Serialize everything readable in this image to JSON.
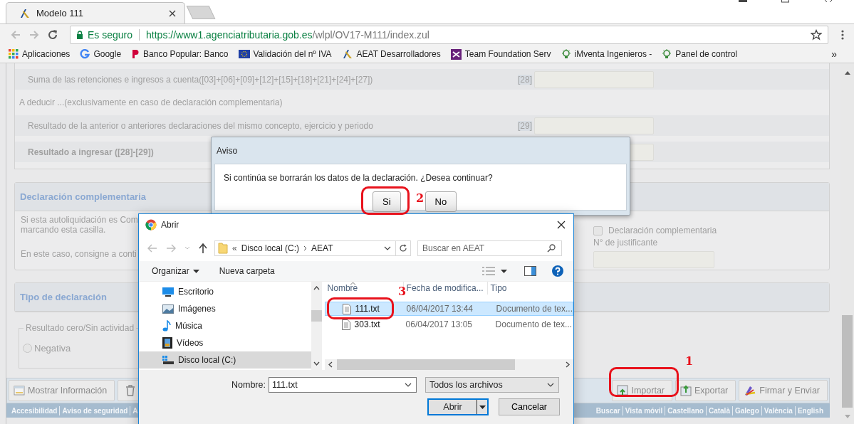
{
  "browser": {
    "tabs": [
      {
        "title": "Modelo 111",
        "selected": true
      }
    ],
    "security": "Es seguro",
    "url_host": "https://www1.agenciatributaria.gob.es",
    "url_path": "/wlpl/OV17-M111/index.zul",
    "bookmarks": [
      {
        "label": "Aplicaciones",
        "kind": "apps"
      },
      {
        "label": "Google",
        "kind": "google"
      },
      {
        "label": "Banco Popular: Banco",
        "kind": "popular"
      },
      {
        "label": "Validación del nº IVA",
        "kind": "eu"
      },
      {
        "label": "AEAT Desarrolladores",
        "kind": "aeat"
      },
      {
        "label": "Team Foundation Serv",
        "kind": "vs"
      },
      {
        "label": "iMventa Ingenieros -",
        "kind": "bulb"
      },
      {
        "label": "Panel de control",
        "kind": "bulb"
      }
    ],
    "more": "»"
  },
  "form": {
    "rows": [
      {
        "kind": "field",
        "label": "Suma de las retenciones e ingresos a cuenta([03]+[06]+[09]+[12]+[15]+[18]+[21]+[24]+[27])",
        "code": "[28]",
        "bold": false
      },
      {
        "kind": "note",
        "label": "A deducir ...(exclusivamente en caso de declaración complementaria)"
      },
      {
        "kind": "field",
        "label": "Resultado de la anterior o anteriores declaraciones del mismo concepto, ejercicio y periodo",
        "code": "[29]",
        "bold": false
      },
      {
        "kind": "field",
        "label": "Resultado a ingresar ([28]-[29])",
        "bold": true
      }
    ]
  },
  "complementaria": {
    "title": "Declaración complementaria",
    "lines": [
      "Si esta autoliquidación es Com",
      "marcando esta casilla.",
      "En este caso, consigne a conti"
    ],
    "checkbox": {
      "label": "Declaración complementaria",
      "checked": false
    },
    "justificante_label": "N° de justificante"
  },
  "tipo": {
    "title": "Tipo de declaración",
    "legend": "Resultado cero/Sin actividad",
    "radio": {
      "label": "Negativa",
      "selected": false
    }
  },
  "toolbar": {
    "left": [
      {
        "label": "Mostrar Información",
        "kind": "info"
      },
      {
        "kind": "trash"
      }
    ],
    "right": [
      {
        "label": "Importar",
        "kind": "import"
      },
      {
        "label": "Exportar",
        "kind": "export"
      },
      {
        "label": "Firmar y Enviar",
        "kind": "sign"
      }
    ]
  },
  "footer": {
    "left": [
      "Accesibilidad",
      "Aviso de seguridad",
      "A"
    ],
    "right": [
      "Buscar",
      "Vista móvil",
      "Castellano",
      "Català",
      "Galego",
      "València",
      "English"
    ]
  },
  "aviso": {
    "title": "Aviso",
    "message": "Si continúa se borrarán los datos de la declaración. ¿Desea continuar?",
    "buttons": [
      "Si",
      "No"
    ]
  },
  "abrir": {
    "title": "Abrir",
    "path_overflow": "«",
    "path": [
      "Disco local (C:)",
      "AEAT"
    ],
    "search_placeholder": "Buscar en AEAT",
    "commands": [
      "Organizar",
      "Nueva carpeta"
    ],
    "nav": [
      {
        "label": "Escritorio",
        "kind": "desktop",
        "selected": false
      },
      {
        "label": "Imágenes",
        "kind": "pictures",
        "selected": false
      },
      {
        "label": "Música",
        "kind": "music",
        "selected": false
      },
      {
        "label": "Vídeos",
        "kind": "videos",
        "selected": false
      },
      {
        "label": "Disco local (C:)",
        "kind": "drive",
        "selected": true
      }
    ],
    "columns": [
      "Nombre",
      "Fecha de modifica...",
      "Tipo"
    ],
    "files": [
      {
        "name": "111.txt",
        "date": "06/04/2017 13:44",
        "type": "Documento de tex...",
        "selected": true
      },
      {
        "name": "303.txt",
        "date": "06/04/2017 13:05",
        "type": "Documento de tex...",
        "selected": false
      }
    ],
    "filename_label": "Nombre:",
    "filename": "111.txt",
    "filter": "Todos los archivos",
    "open": "Abrir",
    "cancel": "Cancelar"
  },
  "annotations": [
    "1",
    "2",
    "3"
  ]
}
